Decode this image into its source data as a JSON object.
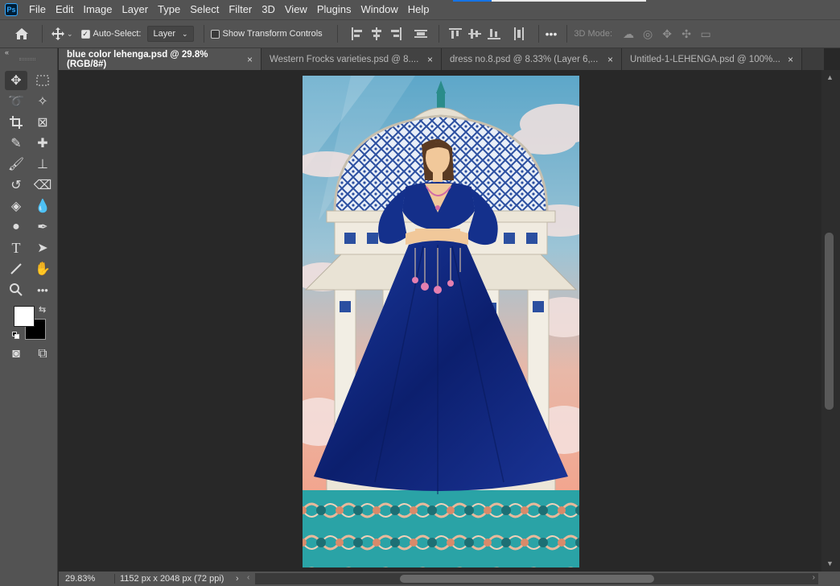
{
  "app": {
    "logo_text": "Ps"
  },
  "menu": [
    "File",
    "Edit",
    "Image",
    "Layer",
    "Type",
    "Select",
    "Filter",
    "3D",
    "View",
    "Plugins",
    "Window",
    "Help"
  ],
  "options": {
    "auto_select_label": "Auto-Select:",
    "auto_select_checked": true,
    "auto_select_target": "Layer",
    "show_transform_label": "Show Transform Controls",
    "show_transform_checked": false,
    "more_label": "•••",
    "mode_3d_label": "3D Mode:"
  },
  "tabs": [
    {
      "label": "blue color lehenga.psd @ 29.8% (RGB/8#)",
      "active": true
    },
    {
      "label": "Western Frocks varieties.psd @ 8....",
      "active": false
    },
    {
      "label": "dress no.8.psd @ 8.33% (Layer 6,...",
      "active": false
    },
    {
      "label": "Untitled-1-LEHENGA.psd @ 100%...",
      "active": false
    }
  ],
  "tab_close": "×",
  "tools": {
    "collapse": "«",
    "swap": "⇆",
    "more": "•••"
  },
  "colors": {
    "foreground": "#ffffff",
    "background": "#000000",
    "lehenga": "#10257a",
    "sky": "#6ea8c4"
  },
  "status": {
    "zoom": "29.83%",
    "doc_size": "1152 px x 2048 px (72 ppi)",
    "caret": "›"
  },
  "scroll": {
    "up": "▲",
    "down": "▼",
    "left": "‹",
    "right": "›"
  }
}
